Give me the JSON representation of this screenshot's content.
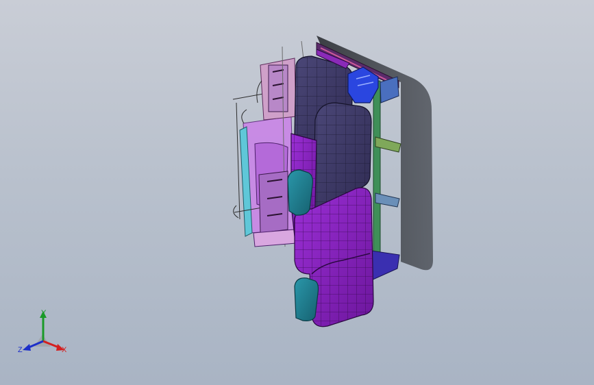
{
  "viewport": {
    "background_top": "#c9cdd6",
    "background_bottom": "#a9b4c4"
  },
  "model": {
    "description_colors": {
      "seat_dark": "#3f3a66",
      "seat_purple": "#8a1fbf",
      "bracket_blue": "#2a46e0",
      "trim_teal": "#1f7f93",
      "frame_pink": "#c987e6",
      "shadow": "#3e4147"
    }
  },
  "triad": {
    "x_label": "X",
    "y_label": "Y",
    "z_label": "Z",
    "x_color": "#d42020",
    "y_color": "#1a9a28",
    "z_color": "#1c2fc9"
  }
}
